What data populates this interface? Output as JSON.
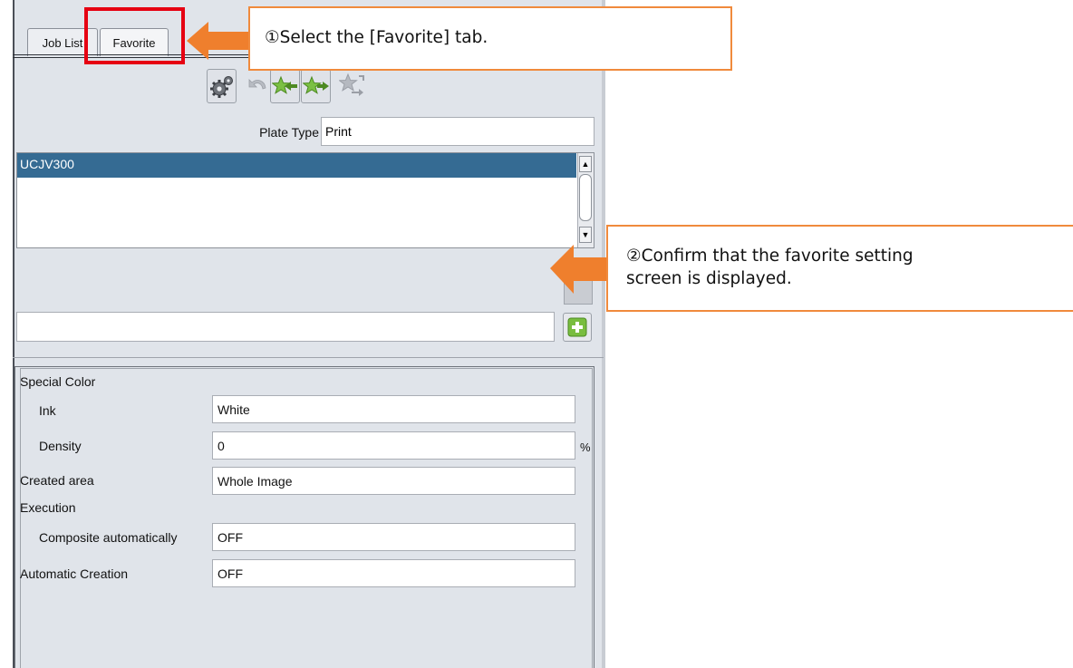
{
  "tabs": [
    {
      "label": "Job List"
    },
    {
      "label": "Favorite"
    }
  ],
  "toolbar": {
    "icons": [
      "settings-gears-icon",
      "undo-icon",
      "favorite-import-icon",
      "favorite-export-icon",
      "favorite-move-icon"
    ]
  },
  "plate_type": {
    "label": "Plate Type",
    "value": "Print"
  },
  "favorites_list": {
    "items": [
      {
        "label": "UCJV300",
        "selected": true
      }
    ]
  },
  "name_input": {
    "value": ""
  },
  "settings": {
    "special_color_label": "Special Color",
    "ink_label": "Ink",
    "ink_value": "White",
    "density_label": "Density",
    "density_value": "0",
    "density_unit": "%",
    "created_area_label": "Created area",
    "created_area_value": "Whole Image",
    "execution_label": "Execution",
    "composite_label": "Composite automatically",
    "composite_value": "OFF",
    "auto_creation_label": "Automatic Creation",
    "auto_creation_value": "OFF"
  },
  "callouts": [
    {
      "text": "①Select the [Favorite] tab."
    },
    {
      "line1": "②Confirm that the favorite setting",
      "line2": "screen is displayed."
    }
  ],
  "colors": {
    "highlight": "#e60012",
    "callout_border": "#f08a3c",
    "arrow": "#ef7f2d",
    "selection": "#356b93"
  }
}
